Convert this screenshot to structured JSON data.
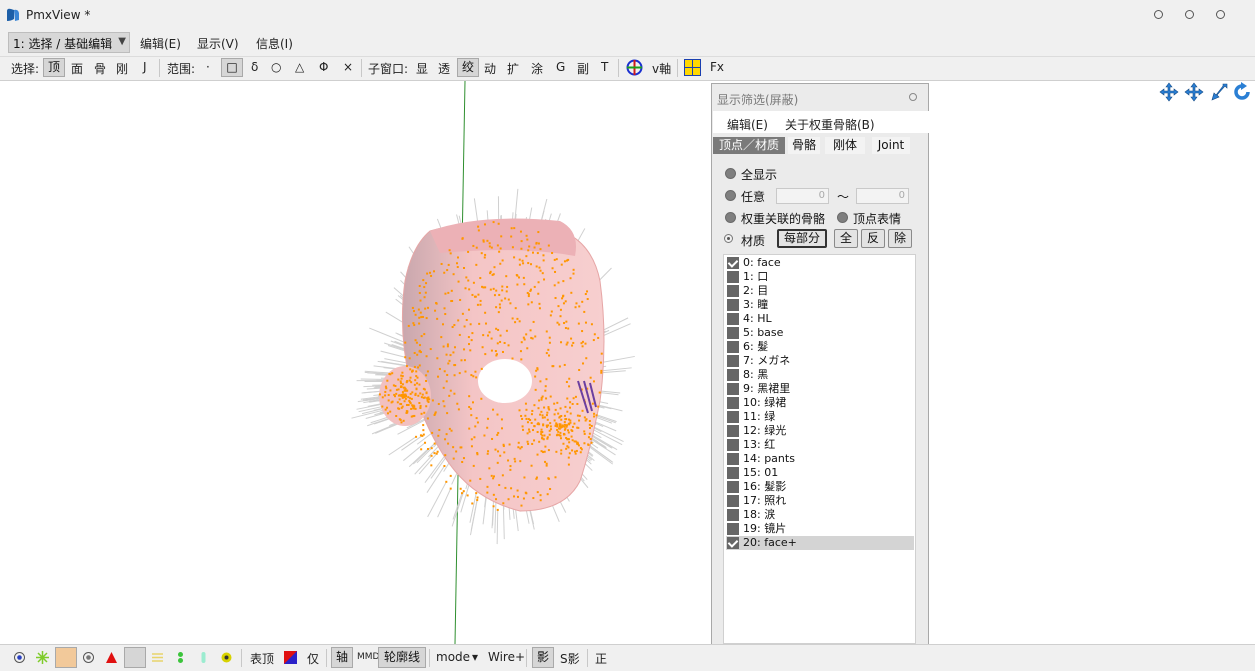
{
  "window": {
    "title": "PmxView *"
  },
  "menubar": {
    "mode": "1: 选择 / 基础编辑",
    "items": [
      "编辑(E)",
      "显示(V)",
      "信息(I)"
    ]
  },
  "toolbar": {
    "select_label": "选择:",
    "select_items": [
      "顶",
      "面",
      "骨",
      "刚",
      "J"
    ],
    "range_label": "范围:",
    "range_items": [
      "·",
      "□",
      "δ",
      "○",
      "△",
      "Φ",
      "×"
    ],
    "subwin_label": "子窗口:",
    "subwin_items": [
      "显",
      "透",
      "绞",
      "动",
      "扩",
      "涂",
      "G",
      "副",
      "T"
    ],
    "axis_label": "v軸",
    "fx_label": "Fx"
  },
  "panel": {
    "title": "显示筛选(屏蔽)",
    "menu": [
      "编辑(E)",
      "关于权重骨骼(B)"
    ],
    "tabs": [
      "顶点／材质",
      "骨骼",
      "刚体",
      "Joint"
    ],
    "options": {
      "all": "全显示",
      "any": "任意",
      "any_from": "0",
      "tilde": "〜",
      "any_to": "0",
      "weight_bones": "权重关联的骨骼",
      "vertex_morph": "顶点表情",
      "material": "材质",
      "per_part": "每部分",
      "btn_all": "全",
      "btn_invert": "反",
      "btn_remove": "除"
    },
    "materials": [
      {
        "label": "0: face",
        "checked": true
      },
      {
        "label": "1: 口",
        "checked": false
      },
      {
        "label": "2: 目",
        "checked": false
      },
      {
        "label": "3: 瞳",
        "checked": false
      },
      {
        "label": "4: HL",
        "checked": false
      },
      {
        "label": "5: base",
        "checked": false
      },
      {
        "label": "6: 髮",
        "checked": false
      },
      {
        "label": "7: メガネ",
        "checked": false
      },
      {
        "label": "8: 黑",
        "checked": false
      },
      {
        "label": "9: 黑裙里",
        "checked": false
      },
      {
        "label": "10: 绿裙",
        "checked": false
      },
      {
        "label": "11: 绿",
        "checked": false
      },
      {
        "label": "12: 绿光",
        "checked": false
      },
      {
        "label": "13: 红",
        "checked": false
      },
      {
        "label": "14: pants",
        "checked": false
      },
      {
        "label": "15: 01",
        "checked": false
      },
      {
        "label": "16: 髮影",
        "checked": false
      },
      {
        "label": "17: 照れ",
        "checked": false
      },
      {
        "label": "18: 涙",
        "checked": false
      },
      {
        "label": "19: 镜片",
        "checked": false
      },
      {
        "label": "20: face+",
        "checked": true
      }
    ]
  },
  "bottombar": {
    "vertex_label": "表顶",
    "only_label": "仅",
    "axis_label": "轴",
    "mmd_label": "MMD",
    "outline_label": "轮廓线",
    "mode_label": "mode",
    "mode_arrow": "▾",
    "wire_label": "Wire+",
    "shadow_label": "影",
    "sshadow_label": "S影",
    "ortho_label": "正"
  },
  "colors": {
    "mesh_fill": "#f3c2c2",
    "vertex": "#ff9600",
    "normal": "#d0d0d0",
    "y_axis": "#2f8f2f",
    "nav_icon": "#2a7fd4"
  }
}
